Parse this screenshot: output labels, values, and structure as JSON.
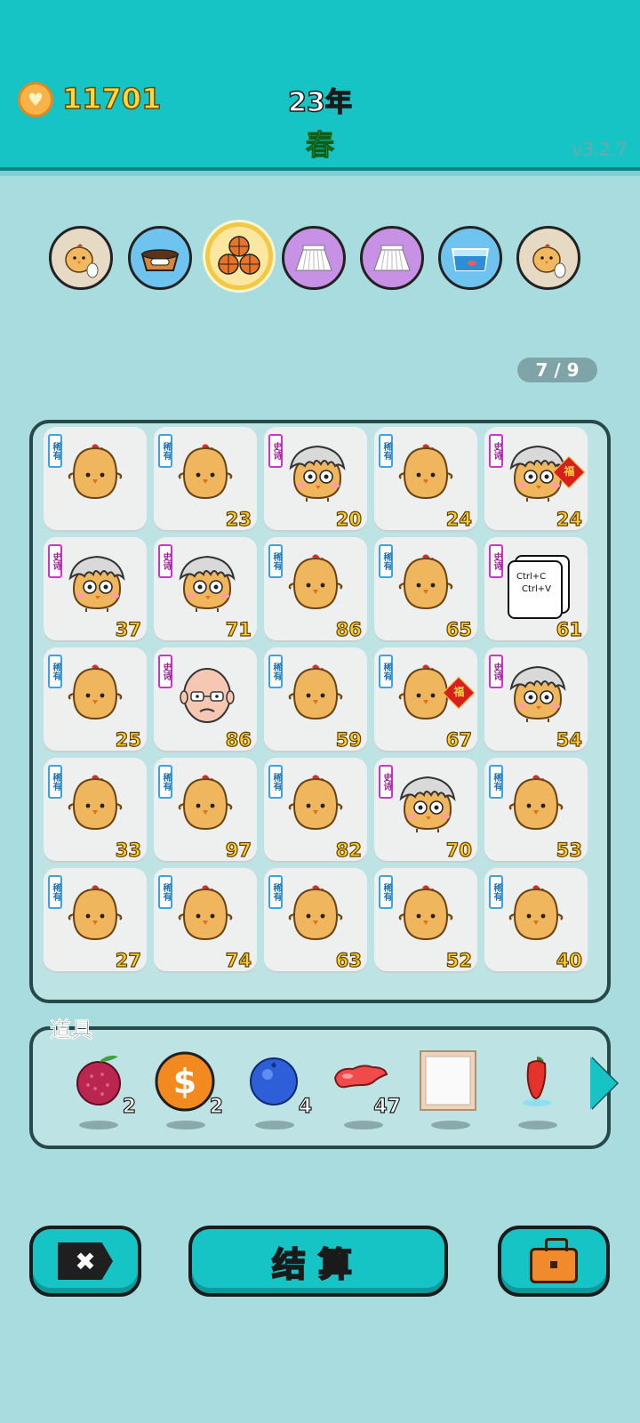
{
  "header": {
    "coins": "11701",
    "year": "23年",
    "season": "春",
    "version": "v3.2.7",
    "colors": {
      "bar": "#16c4c6",
      "coins_text": "#ffd83d",
      "season_text": "#2fbf3e"
    }
  },
  "slots": [
    {
      "icon": "chick-egg-icon",
      "bg": "beige"
    },
    {
      "icon": "dog-bowl-icon",
      "bg": "blue"
    },
    {
      "icon": "basketballs-icon",
      "bg": "gold",
      "selected": true
    },
    {
      "icon": "pleated-skirt-icon",
      "bg": "purple"
    },
    {
      "icon": "pleated-skirt-icon",
      "bg": "purple"
    },
    {
      "icon": "fish-tank-icon",
      "bg": "blue"
    },
    {
      "icon": "chick-egg-icon",
      "bg": "beige"
    }
  ],
  "progress": "7 / 9",
  "board": {
    "cards": [
      {
        "tag": "稀有",
        "kind": "chick",
        "num": ""
      },
      {
        "tag": "稀有",
        "kind": "chick",
        "num": "23"
      },
      {
        "tag": "史诗",
        "kind": "gray-hair",
        "num": "20"
      },
      {
        "tag": "稀有",
        "kind": "chick",
        "num": "24"
      },
      {
        "tag": "史诗",
        "kind": "gray-hair",
        "num": "24",
        "fu": "福"
      },
      {
        "tag": "史诗",
        "kind": "gray-hair",
        "num": "37"
      },
      {
        "tag": "史诗",
        "kind": "gray-hair",
        "num": "71"
      },
      {
        "tag": "稀有",
        "kind": "chick",
        "num": "86"
      },
      {
        "tag": "稀有",
        "kind": "chick",
        "num": "65"
      },
      {
        "tag": "史诗",
        "kind": "ctrl",
        "num": "61",
        "ctrl_c": "Ctrl+C",
        "ctrl_v": "Ctrl+V"
      },
      {
        "tag": "稀有",
        "kind": "chick",
        "num": "25"
      },
      {
        "tag": "史诗",
        "kind": "bald",
        "num": "86"
      },
      {
        "tag": "稀有",
        "kind": "chick",
        "num": "59"
      },
      {
        "tag": "稀有",
        "kind": "chick",
        "num": "67",
        "fu": "福"
      },
      {
        "tag": "史诗",
        "kind": "gray-hair",
        "num": "54"
      },
      {
        "tag": "稀有",
        "kind": "chick",
        "num": "33"
      },
      {
        "tag": "稀有",
        "kind": "chick",
        "num": "97"
      },
      {
        "tag": "稀有",
        "kind": "chick",
        "num": "82"
      },
      {
        "tag": "史诗",
        "kind": "gray-hair",
        "num": "70"
      },
      {
        "tag": "稀有",
        "kind": "chick",
        "num": "53"
      },
      {
        "tag": "稀有",
        "kind": "chick",
        "num": "27"
      },
      {
        "tag": "稀有",
        "kind": "chick",
        "num": "74"
      },
      {
        "tag": "稀有",
        "kind": "chick",
        "num": "63"
      },
      {
        "tag": "稀有",
        "kind": "chick",
        "num": "52"
      },
      {
        "tag": "稀有",
        "kind": "chick",
        "num": "40"
      }
    ]
  },
  "items": {
    "label": "道具",
    "list": [
      {
        "icon": "lychee-icon",
        "count": "2"
      },
      {
        "icon": "dollar-coin-icon",
        "count": "2"
      },
      {
        "icon": "blueberry-icon",
        "count": "4"
      },
      {
        "icon": "liver-icon",
        "count": "47"
      },
      {
        "icon": "picture-frame-icon",
        "count": ""
      },
      {
        "icon": "chili-pepper-icon",
        "count": ""
      }
    ]
  },
  "buttons": {
    "close": "✖",
    "settle": "结算",
    "bag_icon": "briefcase-icon"
  }
}
